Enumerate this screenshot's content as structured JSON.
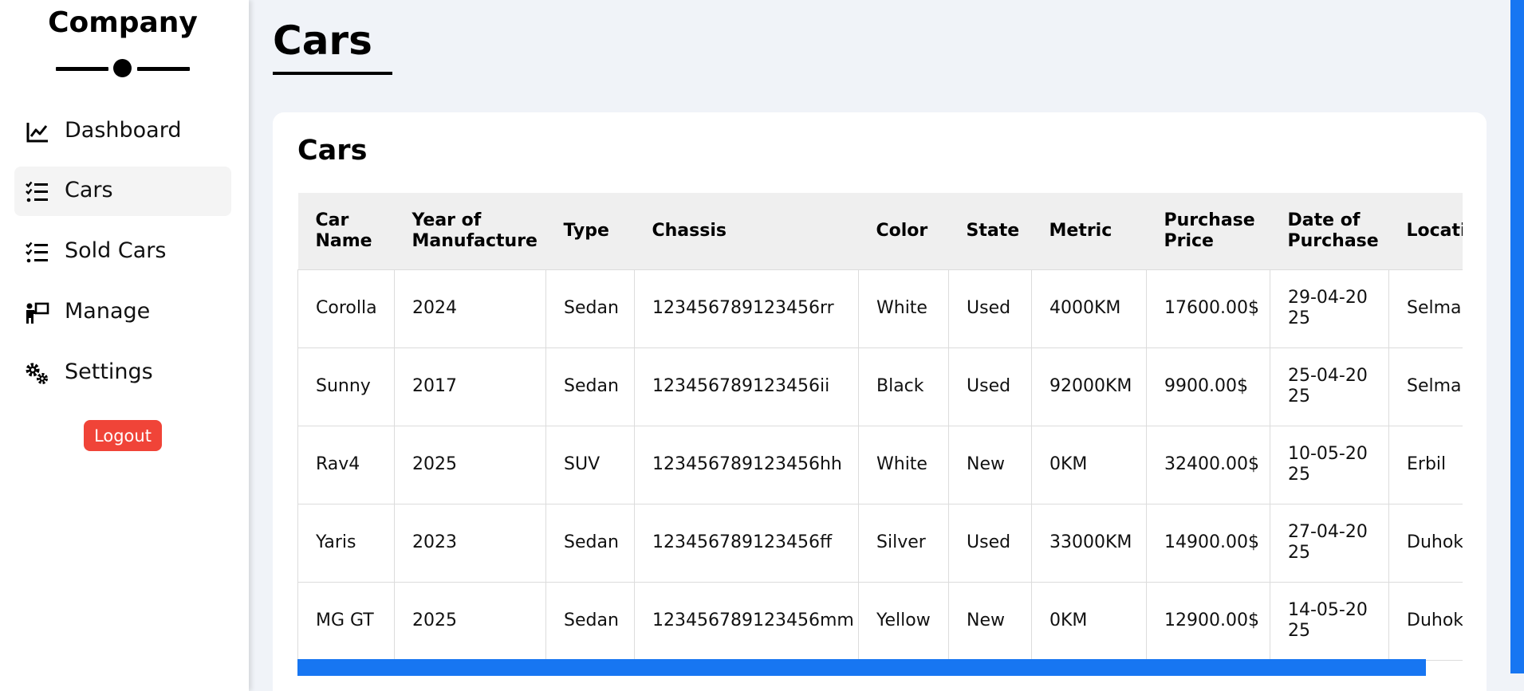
{
  "sidebar": {
    "brand": "Company",
    "items": [
      {
        "label": "Dashboard",
        "icon": "chart-line-icon"
      },
      {
        "label": "Cars",
        "icon": "list-check-icon",
        "active": true
      },
      {
        "label": "Sold Cars",
        "icon": "list-check-icon"
      },
      {
        "label": "Manage",
        "icon": "person-board-icon"
      },
      {
        "label": "Settings",
        "icon": "gears-icon"
      }
    ],
    "logout_label": "Logout"
  },
  "page_title": "Cars",
  "card": {
    "title": "Cars",
    "columns": [
      "Car Name",
      "Year of Manufacture",
      "Type",
      "Chassis",
      "Color",
      "State",
      "Metric",
      "Purchase Price",
      "Date of Purchase",
      "Location"
    ],
    "rows": [
      [
        "Corolla",
        "2024",
        "Sedan",
        "123456789123456rr",
        "White",
        "Used",
        "4000KM",
        "17600.00$",
        "29-04-2025",
        "Selmani"
      ],
      [
        "Sunny",
        "2017",
        "Sedan",
        "123456789123456ii",
        "Black",
        "Used",
        "92000KM",
        "9900.00$",
        "25-04-2025",
        "Selmani"
      ],
      [
        "Rav4",
        "2025",
        "SUV",
        "123456789123456hh",
        "White",
        "New",
        "0KM",
        "32400.00$",
        "10-05-2025",
        "Erbil"
      ],
      [
        "Yaris",
        "2023",
        "Sedan",
        "123456789123456ff",
        "Silver",
        "Used",
        "33000KM",
        "14900.00$",
        "27-04-2025",
        "Duhok"
      ],
      [
        "MG GT",
        "2025",
        "Sedan",
        "123456789123456mm",
        "Yellow",
        "New",
        "0KM",
        "12900.00$",
        "14-05-2025",
        "Duhok"
      ]
    ]
  },
  "colors": {
    "accent": "#1776f2",
    "logout": "#f04438",
    "background": "#f0f3f8"
  }
}
